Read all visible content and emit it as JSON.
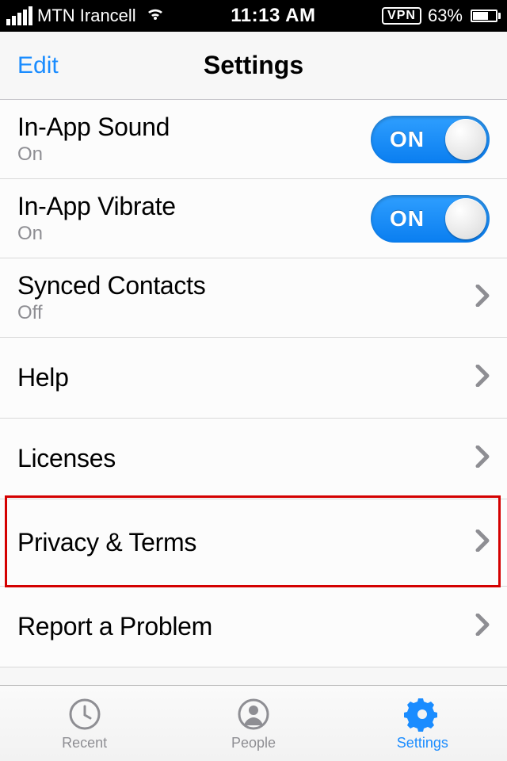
{
  "status": {
    "carrier": "MTN Irancell",
    "time": "11:13 AM",
    "vpn": "VPN",
    "battery_pct": "63%"
  },
  "nav": {
    "edit": "Edit",
    "title": "Settings"
  },
  "rows": {
    "sound": {
      "title": "In-App Sound",
      "sub": "On",
      "toggle": "ON"
    },
    "vibrate": {
      "title": "In-App Vibrate",
      "sub": "On",
      "toggle": "ON"
    },
    "synced": {
      "title": "Synced Contacts",
      "sub": "Off"
    },
    "help": {
      "title": "Help"
    },
    "licenses": {
      "title": "Licenses"
    },
    "privacy": {
      "title": "Privacy & Terms"
    },
    "report": {
      "title": "Report a Problem"
    }
  },
  "tabs": {
    "recent": "Recent",
    "people": "People",
    "settings": "Settings"
  }
}
